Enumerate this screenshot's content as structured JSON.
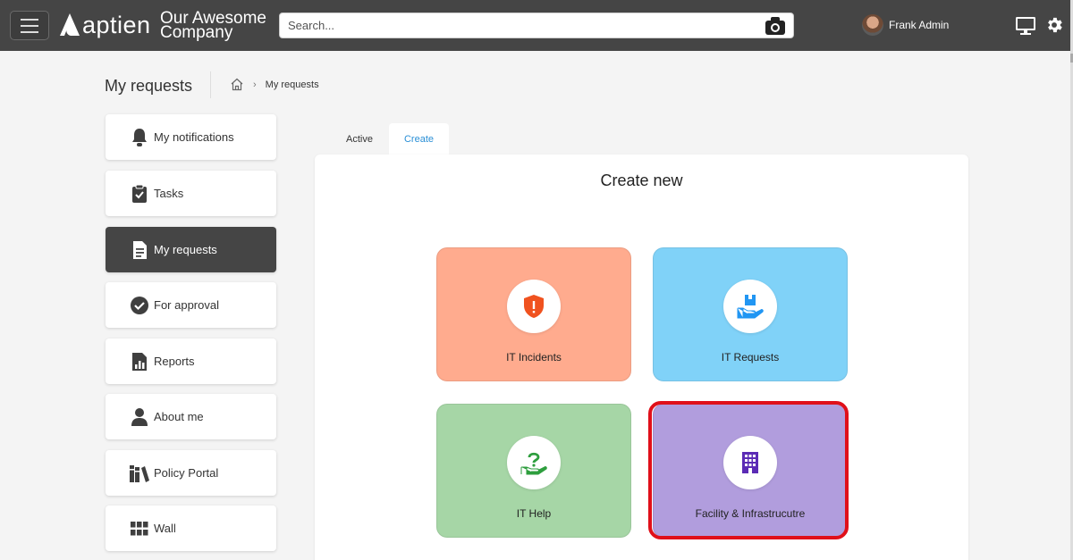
{
  "topbar": {
    "logo_text": "aptien",
    "company_line1": "Our Awesome",
    "company_line2": "Company",
    "search_placeholder": "Search...",
    "user_name": "Frank Admin"
  },
  "header": {
    "page_title": "My requests",
    "breadcrumb_current": "My requests"
  },
  "sidebar": {
    "items": [
      {
        "label": "My notifications",
        "icon": "bell-icon"
      },
      {
        "label": "Tasks",
        "icon": "clipboard-check-icon"
      },
      {
        "label": "My requests",
        "icon": "document-icon",
        "active": true
      },
      {
        "label": "For approval",
        "icon": "check-circle-icon"
      },
      {
        "label": "Reports",
        "icon": "report-icon"
      },
      {
        "label": "About me",
        "icon": "person-icon"
      },
      {
        "label": "Policy Portal",
        "icon": "books-icon"
      },
      {
        "label": "Wall",
        "icon": "grid-icon"
      }
    ]
  },
  "tabs": {
    "active_label": "Active",
    "create_label": "Create",
    "selected": "Create"
  },
  "panel": {
    "title": "Create new",
    "cards": [
      {
        "label": "IT Incidents",
        "icon": "shield-alert-icon",
        "color": "#ffab8e"
      },
      {
        "label": "IT Requests",
        "icon": "hand-box-icon",
        "color": "#80d2f8"
      },
      {
        "label": "IT Help",
        "icon": "hand-help-icon",
        "color": "#a6d6a6"
      },
      {
        "label": "Facility & Infrastrucutre",
        "icon": "building-icon",
        "color": "#b19ddd"
      }
    ]
  },
  "colors": {
    "topbar": "#454545",
    "accent": "#2a8fd6",
    "highlight": "#e0101a"
  }
}
